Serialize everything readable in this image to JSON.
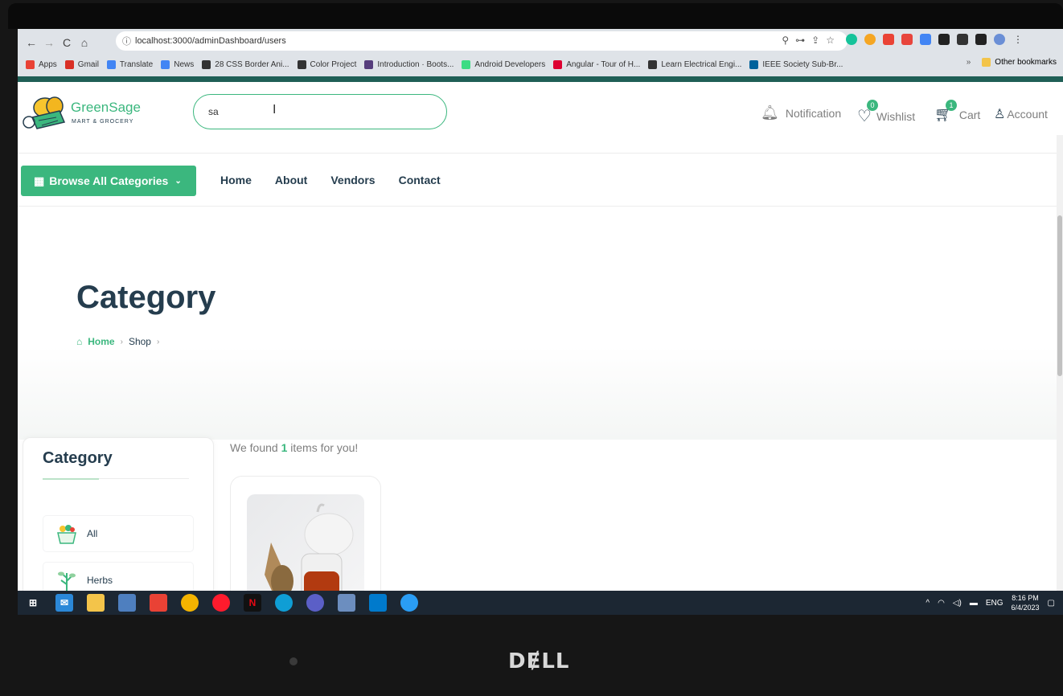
{
  "browser": {
    "url": "localhost:3000/adminDashboard/users",
    "bookmarks": [
      {
        "label": "Apps",
        "color": "#e94235"
      },
      {
        "label": "Gmail",
        "color": "#d93025"
      },
      {
        "label": "Translate",
        "color": "#4285f4"
      },
      {
        "label": "News",
        "color": "#4285f4"
      },
      {
        "label": "28 CSS Border Ani...",
        "color": "#333333"
      },
      {
        "label": "Color Project",
        "color": "#333333"
      },
      {
        "label": "Introduction · Boots...",
        "color": "#563d7c"
      },
      {
        "label": "Android Developers",
        "color": "#3ddc84"
      },
      {
        "label": "Angular - Tour of H...",
        "color": "#dd0031"
      },
      {
        "label": "Learn Electrical Engi...",
        "color": "#333333"
      },
      {
        "label": "IEEE Society Sub-Br...",
        "color": "#00629b"
      }
    ],
    "more_bookmarks": "»",
    "other_bookmarks": "Other bookmarks"
  },
  "site": {
    "brand": "GreenSage",
    "brand_sub": "MART & GROCERY",
    "search_value": "sa",
    "header": {
      "notification": "Notification",
      "wishlist": "Wishlist",
      "wishlist_count": "0",
      "cart": "Cart",
      "cart_count": "1",
      "account": "Account"
    },
    "browse_label": "Browse All Categories",
    "nav": [
      "Home",
      "About",
      "Vendors",
      "Contact"
    ],
    "page_title": "Category",
    "breadcrumb": {
      "home": "Home",
      "shop": "Shop"
    },
    "sidebar": {
      "title": "Category",
      "items": [
        {
          "label": "All"
        },
        {
          "label": "Herbs"
        }
      ]
    },
    "found_prefix": "We found",
    "found_count": "1",
    "found_suffix": "items for you!"
  },
  "taskbar": {
    "lang": "ENG",
    "time": "8:16 PM",
    "date": "6/4/2023"
  },
  "device_brand": "DELL",
  "colors": {
    "accent": "#3bb77e",
    "heading": "#253d4e"
  }
}
